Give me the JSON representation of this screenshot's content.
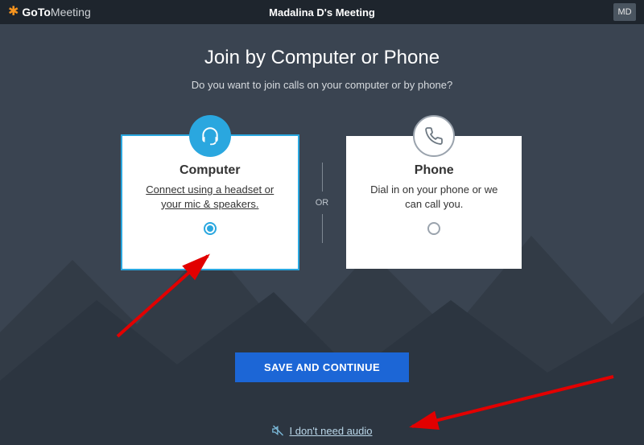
{
  "header": {
    "brand_bold": "GoTo",
    "brand_light": "Meeting",
    "meeting_title": "Madalina D's Meeting",
    "user_initials": "MD"
  },
  "main": {
    "heading": "Join by Computer or Phone",
    "subheading": "Do you want to join calls on your computer or by phone?",
    "or_label": "OR",
    "options": {
      "computer": {
        "title": "Computer",
        "description": "Connect using a headset or your mic & speakers.",
        "selected": true
      },
      "phone": {
        "title": "Phone",
        "description": "Dial in on your phone or we can call you.",
        "selected": false
      }
    },
    "primary_button": "SAVE AND CONTINUE",
    "skip_audio_label": "I don't need audio"
  },
  "colors": {
    "accent_blue": "#2aa7df",
    "button_blue": "#1c66d6",
    "brand_orange": "#f7941e"
  }
}
